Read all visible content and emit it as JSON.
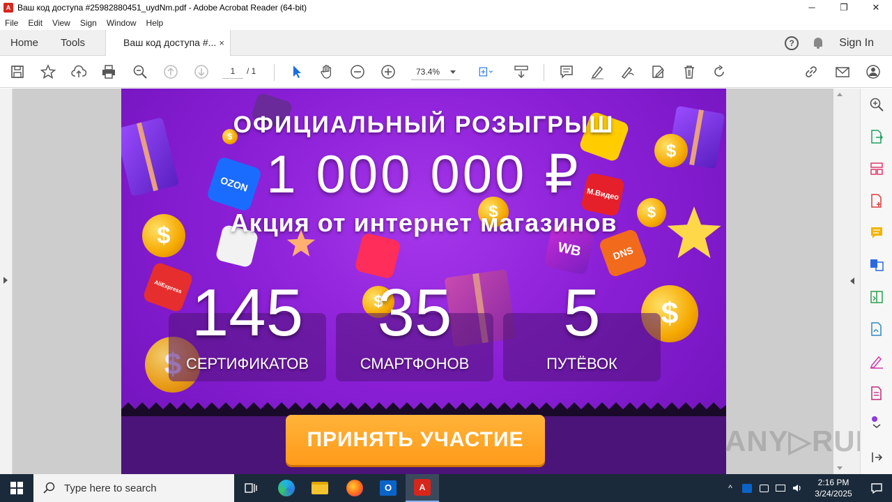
{
  "window": {
    "title": "Ваш код доступа #25982880451_uydNm.pdf - Adobe Acrobat Reader (64-bit)",
    "minimize": "─",
    "maximize": "❐",
    "close": "✕"
  },
  "menu": [
    "File",
    "Edit",
    "View",
    "Sign",
    "Window",
    "Help"
  ],
  "tabs": {
    "home": "Home",
    "tools": "Tools",
    "document": "Ваш код доступа #...",
    "close": "×",
    "sign_in": "Sign In",
    "help": "?"
  },
  "toolbar": {
    "page_current": "1",
    "page_total": "/  1",
    "zoom": "73.4%"
  },
  "pdf": {
    "title": "ОФИЦИАЛЬНЫЙ РОЗЫГРЫШ",
    "amount": "1 000 000 ₽",
    "subtitle": "Акция от интернет магазинов",
    "stats": [
      {
        "value": "145",
        "label": "СЕРТИФИКАТОВ"
      },
      {
        "value": "35",
        "label": "СМАРТФОНОВ"
      },
      {
        "value": "5",
        "label": "ПУТЁВОК"
      }
    ],
    "cta": "ПРИНЯТЬ УЧАСТИЕ",
    "logos": [
      "OZON",
      "WB",
      "DNS",
      "М.Видео",
      "AliExpress"
    ],
    "accent_colors": {
      "purple": "#8a1fd6",
      "cta": "#ff9a1a"
    }
  },
  "watermark": "ANY▷RUN",
  "taskbar": {
    "search_placeholder": "Type here to search",
    "time": "2:16 PM",
    "date": "3/24/2025"
  }
}
